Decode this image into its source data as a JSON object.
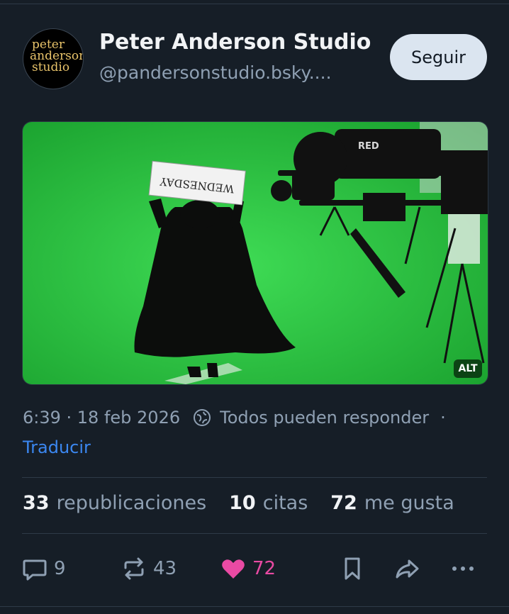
{
  "post": {
    "author_name": "Peter Anderson Studio",
    "author_handle": "@pandersonstudio.bsky....",
    "avatar_logo": [
      "peter",
      "anderson",
      "studio"
    ],
    "follow_label": "Seguir",
    "image": {
      "alt_badge": "ALT",
      "sign_text": "WEDNESDAY",
      "camera_brand": "RED"
    },
    "time": "6:39 · 18 feb 2026",
    "reply_setting": "Todos pueden responder",
    "separator": "·",
    "translate_label": "Traducir"
  },
  "stats": {
    "reposts_count": "33",
    "reposts_label": "republicaciones",
    "quotes_count": "10",
    "quotes_label": "citas",
    "likes_count": "72",
    "likes_label": "me gusta"
  },
  "actions": {
    "reply_count": "9",
    "repost_count": "43",
    "like_count": "72"
  },
  "colors": {
    "background": "#161e27",
    "link": "#3b87f0",
    "like": "#e94aa3",
    "greenscreen": "#22c43a"
  }
}
